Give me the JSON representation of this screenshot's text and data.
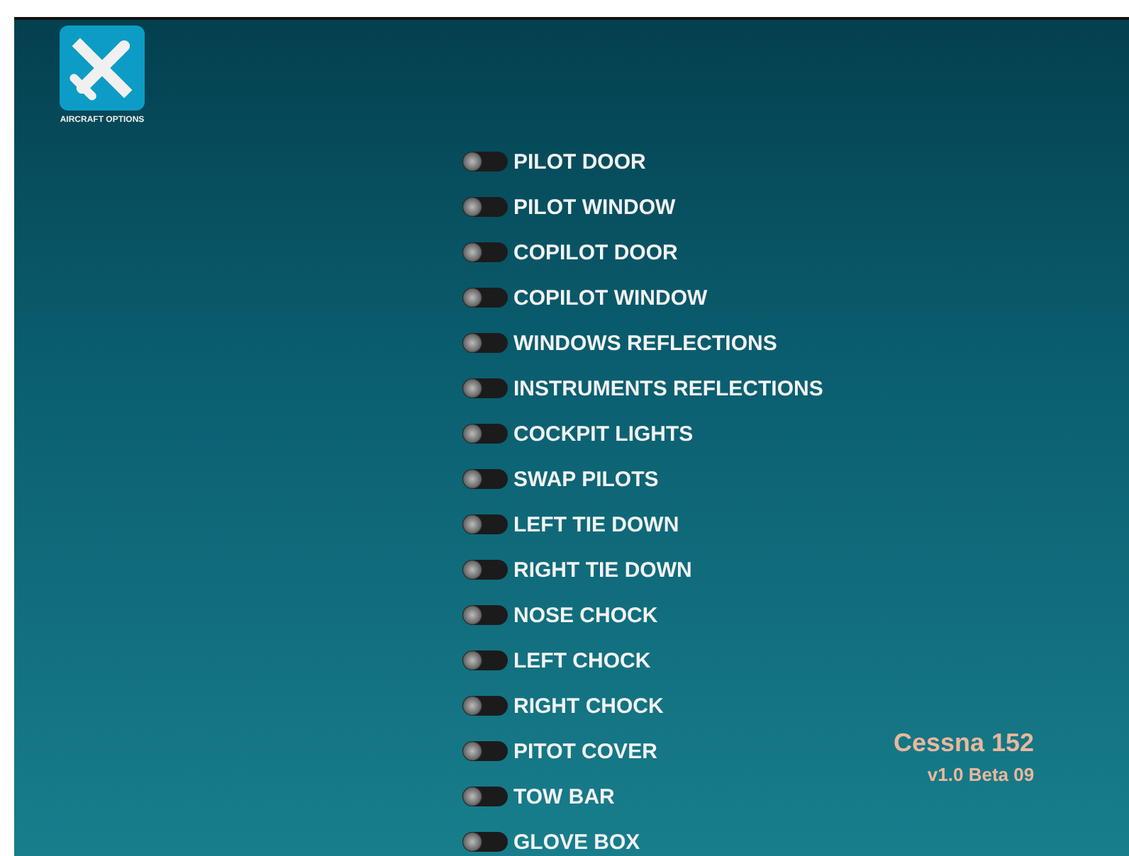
{
  "app_button": {
    "label": "AIRCRAFT OPTIONS"
  },
  "options": [
    {
      "label": "PILOT DOOR",
      "on": false
    },
    {
      "label": "PILOT WINDOW",
      "on": false
    },
    {
      "label": "COPILOT DOOR",
      "on": false
    },
    {
      "label": "COPILOT WINDOW",
      "on": false
    },
    {
      "label": "WINDOWS REFLECTIONS",
      "on": false
    },
    {
      "label": "INSTRUMENTS REFLECTIONS",
      "on": false
    },
    {
      "label": "COCKPIT LIGHTS",
      "on": false
    },
    {
      "label": "SWAP PILOTS",
      "on": false
    },
    {
      "label": "LEFT TIE DOWN",
      "on": false
    },
    {
      "label": "RIGHT TIE DOWN",
      "on": false
    },
    {
      "label": "NOSE CHOCK",
      "on": false
    },
    {
      "label": "LEFT CHOCK",
      "on": false
    },
    {
      "label": "RIGHT CHOCK",
      "on": false
    },
    {
      "label": "PITOT COVER",
      "on": false
    },
    {
      "label": "TOW BAR",
      "on": false
    },
    {
      "label": "GLOVE BOX",
      "on": false
    }
  ],
  "aircraft": {
    "name": "Cessna 152",
    "version": "v1.0 Beta 09"
  }
}
